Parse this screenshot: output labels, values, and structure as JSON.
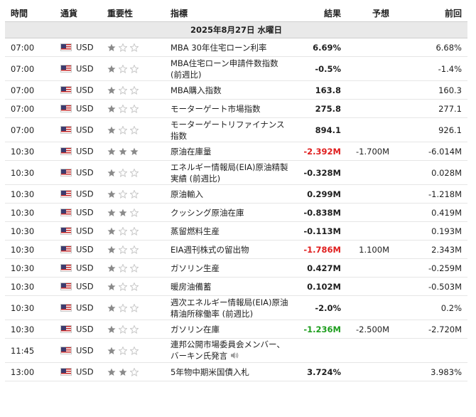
{
  "columns": {
    "time": "時間",
    "currency": "通貨",
    "importance": "重要性",
    "event": "指標",
    "actual": "結果",
    "forecast": "予想",
    "previous": "前回"
  },
  "date_header": "2025年8月27日 水曜日",
  "colors": {
    "negative": "#e01e1e",
    "positive": "#1e9e1e",
    "star_filled": "#8a8a8a",
    "star_empty": "#c8c8c8"
  },
  "icons": {
    "flag": "us-flag-icon",
    "star": "star-icon",
    "speaker": "speaker-icon"
  },
  "rows": [
    {
      "time": "07:00",
      "currency": "USD",
      "importance": 1,
      "event": "MBA 30年住宅ローン利率",
      "actual": "6.69%",
      "actual_color": "",
      "forecast": "",
      "previous": "6.68%",
      "tall": false,
      "audio": false
    },
    {
      "time": "07:00",
      "currency": "USD",
      "importance": 1,
      "event": "MBA住宅ローン申請件数指数 (前週比)",
      "actual": "-0.5%",
      "actual_color": "",
      "forecast": "",
      "previous": "-1.4%",
      "tall": true,
      "audio": false
    },
    {
      "time": "07:00",
      "currency": "USD",
      "importance": 1,
      "event": "MBA購入指数",
      "actual": "163.8",
      "actual_color": "",
      "forecast": "",
      "previous": "160.3",
      "tall": false,
      "audio": false
    },
    {
      "time": "07:00",
      "currency": "USD",
      "importance": 1,
      "event": "モーターゲート市場指数",
      "actual": "275.8",
      "actual_color": "",
      "forecast": "",
      "previous": "277.1",
      "tall": false,
      "audio": false
    },
    {
      "time": "07:00",
      "currency": "USD",
      "importance": 1,
      "event": "モーターゲートリファイナンス指数",
      "actual": "894.1",
      "actual_color": "",
      "forecast": "",
      "previous": "926.1",
      "tall": true,
      "audio": false
    },
    {
      "time": "10:30",
      "currency": "USD",
      "importance": 3,
      "event": "原油在庫量",
      "actual": "-2.392M",
      "actual_color": "neg",
      "forecast": "-1.700M",
      "previous": "-6.014M",
      "tall": false,
      "audio": false
    },
    {
      "time": "10:30",
      "currency": "USD",
      "importance": 1,
      "event": "エネルギー情報局(EIA)原油精製実績 (前週比)",
      "actual": "-0.328M",
      "actual_color": "",
      "forecast": "",
      "previous": "0.028M",
      "tall": true,
      "audio": false
    },
    {
      "time": "10:30",
      "currency": "USD",
      "importance": 1,
      "event": "原油輸入",
      "actual": "0.299M",
      "actual_color": "",
      "forecast": "",
      "previous": "-1.218M",
      "tall": false,
      "audio": false
    },
    {
      "time": "10:30",
      "currency": "USD",
      "importance": 2,
      "event": "クッシング原油在庫",
      "actual": "-0.838M",
      "actual_color": "",
      "forecast": "",
      "previous": "0.419M",
      "tall": false,
      "audio": false
    },
    {
      "time": "10:30",
      "currency": "USD",
      "importance": 1,
      "event": "蒸留燃料生産",
      "actual": "-0.113M",
      "actual_color": "",
      "forecast": "",
      "previous": "0.193M",
      "tall": false,
      "audio": false
    },
    {
      "time": "10:30",
      "currency": "USD",
      "importance": 1,
      "event": "EIA週刊株式の留出物",
      "actual": "-1.786M",
      "actual_color": "neg",
      "forecast": "1.100M",
      "previous": "2.343M",
      "tall": false,
      "audio": false
    },
    {
      "time": "10:30",
      "currency": "USD",
      "importance": 1,
      "event": "ガソリン生産",
      "actual": "0.427M",
      "actual_color": "",
      "forecast": "",
      "previous": "-0.259M",
      "tall": false,
      "audio": false
    },
    {
      "time": "10:30",
      "currency": "USD",
      "importance": 1,
      "event": "暖房油備蓄",
      "actual": "0.102M",
      "actual_color": "",
      "forecast": "",
      "previous": "-0.503M",
      "tall": false,
      "audio": false
    },
    {
      "time": "10:30",
      "currency": "USD",
      "importance": 1,
      "event": "週次エネルギー情報局(EIA)原油精油所稼働率 (前週比)",
      "actual": "-2.0%",
      "actual_color": "",
      "forecast": "",
      "previous": "0.2%",
      "tall": true,
      "audio": false
    },
    {
      "time": "10:30",
      "currency": "USD",
      "importance": 1,
      "event": "ガソリン在庫",
      "actual": "-1.236M",
      "actual_color": "pos",
      "forecast": "-2.500M",
      "previous": "-2.720M",
      "tall": false,
      "audio": false
    },
    {
      "time": "11:45",
      "currency": "USD",
      "importance": 1,
      "event": "連邦公開市場委員会メンバー、バーキン氏発言",
      "actual": "",
      "actual_color": "",
      "forecast": "",
      "previous": "",
      "tall": true,
      "audio": true
    },
    {
      "time": "13:00",
      "currency": "USD",
      "importance": 2,
      "event": "5年物中期米国債入札",
      "actual": "3.724%",
      "actual_color": "",
      "forecast": "",
      "previous": "3.983%",
      "tall": false,
      "audio": false
    }
  ]
}
